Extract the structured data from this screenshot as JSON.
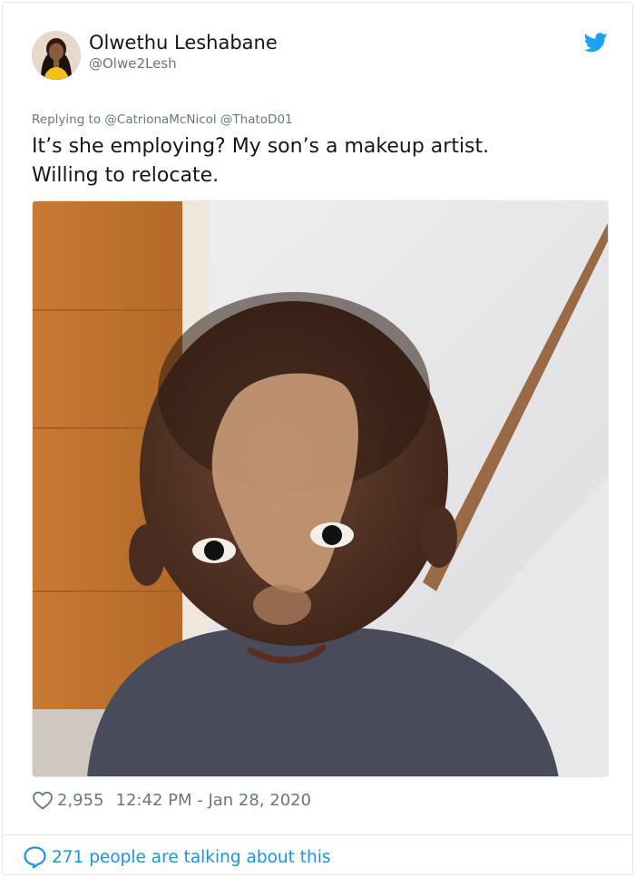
{
  "author": {
    "display_name": "Olwethu Leshabane",
    "handle": "@Olwe2Lesh",
    "avatar_icon": "profile-photo"
  },
  "brand": {
    "icon": "twitter-bird-icon",
    "color": "#1da1f2"
  },
  "reply": {
    "prefix": "Replying to",
    "mentions": "@CatrionaMcNicol @ThatoD01"
  },
  "tweet": {
    "text_line1": "It’s she employing? My son’s a makeup artist.",
    "text_line2": "Willing to relocate.",
    "media_icon": "photo-of-toddler-with-makeup"
  },
  "meta": {
    "like_icon": "heart-icon",
    "likes": "2,955",
    "timestamp": "12:42 PM - Jan 28, 2020"
  },
  "engagement": {
    "icon": "speech-bubble-icon",
    "label": "271 people are talking about this",
    "link_color": "#1b95e0"
  }
}
